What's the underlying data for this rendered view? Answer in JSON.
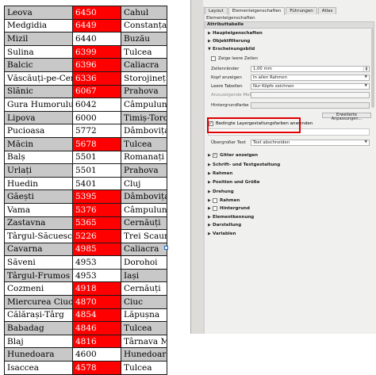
{
  "table": {
    "rows": [
      {
        "a": "Leova",
        "b": "6450",
        "c": "Cahul",
        "red": true,
        "gray": true
      },
      {
        "a": "Medgidia",
        "b": "6449",
        "c": "Constanța",
        "red": true,
        "gray": false
      },
      {
        "a": "Mizil",
        "b": "6440",
        "c": "Buzău",
        "red": false,
        "gray": true
      },
      {
        "a": "Sulina",
        "b": "6399",
        "c": "Tulcea",
        "red": true,
        "gray": false
      },
      {
        "a": "Balcic",
        "b": "6396",
        "c": "Caliacra",
        "red": true,
        "gray": true
      },
      {
        "a": "Văscăuți-pe-Ceremuș",
        "b": "6336",
        "c": "Storojineț",
        "red": true,
        "gray": false
      },
      {
        "a": "Slănic",
        "b": "6067",
        "c": "Prahova",
        "red": true,
        "gray": true
      },
      {
        "a": "Gura Humorului",
        "b": "6042",
        "c": "Câmpulung",
        "red": false,
        "gray": false
      },
      {
        "a": "Lipova",
        "b": "6000",
        "c": "Timiș-Torontal",
        "red": false,
        "gray": true
      },
      {
        "a": "Pucioasa",
        "b": "5772",
        "c": "Dâmbovița",
        "red": false,
        "gray": false
      },
      {
        "a": "Măcin",
        "b": "5678",
        "c": "Tulcea",
        "red": true,
        "gray": true
      },
      {
        "a": "Balș",
        "b": "5501",
        "c": "Romanați",
        "red": false,
        "gray": false
      },
      {
        "a": "Urlați",
        "b": "5501",
        "c": "Prahova",
        "red": false,
        "gray": true
      },
      {
        "a": "Huedin",
        "b": "5401",
        "c": "Cluj",
        "red": false,
        "gray": false
      },
      {
        "a": "Găești",
        "b": "5395",
        "c": "Dâmbovița",
        "red": true,
        "gray": true
      },
      {
        "a": "Vama",
        "b": "5376",
        "c": "Câmpulung",
        "red": true,
        "gray": false
      },
      {
        "a": "Zastavna",
        "b": "5365",
        "c": "Cernăuți",
        "red": true,
        "gray": true
      },
      {
        "a": "Târgul-Săcuesc",
        "b": "5226",
        "c": "Trei Scaune",
        "red": true,
        "gray": false
      },
      {
        "a": "Cavarna",
        "b": "4985",
        "c": "Caliacra",
        "red": true,
        "gray": true
      },
      {
        "a": "Săveni",
        "b": "4953",
        "c": "Dorohoi",
        "red": false,
        "gray": false
      },
      {
        "a": "Târgul-Frumos",
        "b": "4953",
        "c": "Iași",
        "red": false,
        "gray": true
      },
      {
        "a": "Cozmeni",
        "b": "4918",
        "c": "Cernăuți",
        "red": true,
        "gray": false
      },
      {
        "a": "Miercurea Ciuc",
        "b": "4870",
        "c": "Ciuc",
        "red": true,
        "gray": true
      },
      {
        "a": "Călărași-Târg",
        "b": "4854",
        "c": "Lăpușna",
        "red": true,
        "gray": false
      },
      {
        "a": "Babadag",
        "b": "4846",
        "c": "Tulcea",
        "red": true,
        "gray": true
      },
      {
        "a": "Blaj",
        "b": "4816",
        "c": "Târnava Mică",
        "red": true,
        "gray": false
      },
      {
        "a": "Hunedoara",
        "b": "4600",
        "c": "Hunedoara",
        "red": false,
        "gray": true
      },
      {
        "a": "Isaccea",
        "b": "4578",
        "c": "Tulcea",
        "red": true,
        "gray": false
      }
    ]
  },
  "panel": {
    "tabs": [
      "Layout",
      "Elementeigenschaften",
      "Führungen",
      "Atlas"
    ],
    "title": "Elementeigenschaften",
    "subtitle": "Attributtabelle",
    "sections_top": [
      "Haupteigenschaften",
      "Objektfilterung",
      "Erscheinungsbild"
    ],
    "show_empty_rows": "Zeige leere Zeilen",
    "cell_margin_label": "Zellenränder",
    "cell_margin_value": "1,00 mm",
    "header_show_label": "Kopf anzeigen",
    "header_show_value": "In allen Rahmen",
    "empty_tables_label": "Leere Tabellen",
    "empty_tables_value": "Nur Köpfe zeichnen",
    "show_message_label": "Anzuzeigende Meldung",
    "bg_color_label": "Hintergrundfarbe",
    "custom_button": "Erweiterte Anpassungen...",
    "conditional_label": "Bedingte Layergestaltungsfarben anwenden",
    "oversize_label": "Übergroßer Text",
    "oversize_value": "Text abschneiden",
    "sections_bottom": [
      "Gitter anzeigen",
      "Schrift- und Textgestaltung",
      "Rahmen",
      "Position und Größe",
      "Drehung",
      "Rahmen",
      "Hintergrund",
      "Elementkennung",
      "Darstellung",
      "Variablen"
    ]
  }
}
